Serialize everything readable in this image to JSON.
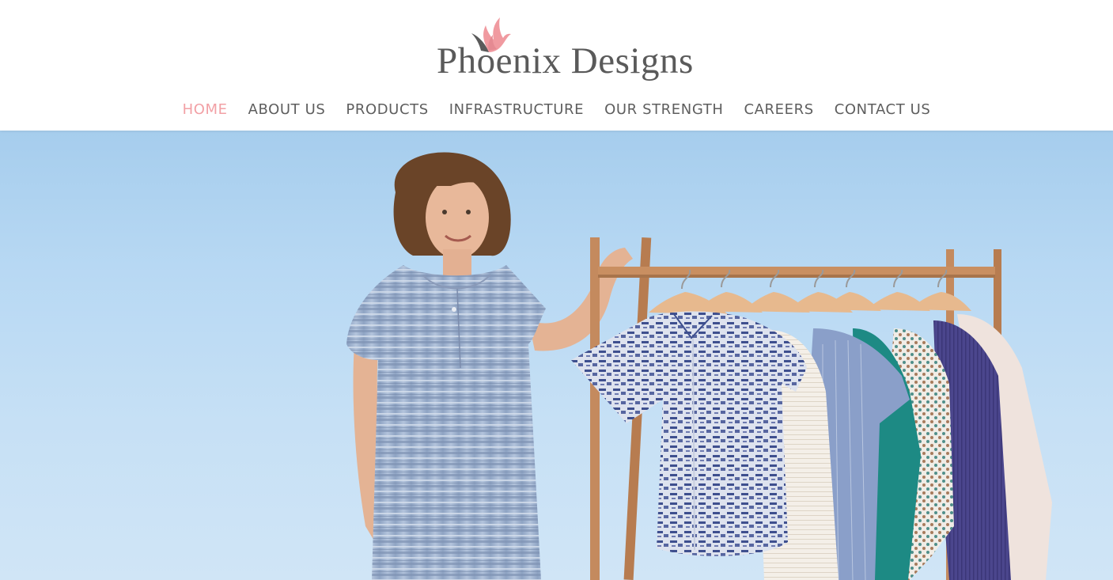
{
  "brand": {
    "logo_text": "Phoenix Designs",
    "accent_color": "#f2a0a5",
    "text_color": "#5e5e5e",
    "logo_icon": "phoenix-bird-icon"
  },
  "nav": {
    "items": [
      {
        "label": "HOME",
        "active": true
      },
      {
        "label": "ABOUT US",
        "active": false
      },
      {
        "label": "PRODUCTS",
        "active": false
      },
      {
        "label": "INFRASTRUCTURE",
        "active": false
      },
      {
        "label": "OUR STRENGTH",
        "active": false
      },
      {
        "label": "CAREERS",
        "active": false
      },
      {
        "label": "CONTACT US",
        "active": false
      }
    ]
  },
  "hero": {
    "image": "model-with-clothing-rack",
    "sky_color": "#b7d8f3"
  }
}
